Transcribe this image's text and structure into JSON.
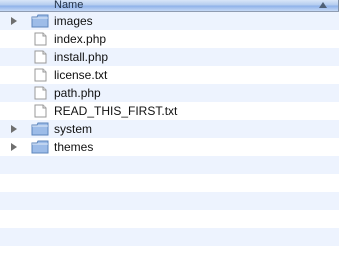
{
  "header": {
    "name_label": "Name"
  },
  "items": [
    {
      "label": "images",
      "type": "folder",
      "icon": "folder-icon",
      "expandable": true
    },
    {
      "label": "index.php",
      "type": "file",
      "icon": "document-icon",
      "expandable": false
    },
    {
      "label": "install.php",
      "type": "file",
      "icon": "document-icon",
      "expandable": false
    },
    {
      "label": "license.txt",
      "type": "file",
      "icon": "document-icon",
      "expandable": false
    },
    {
      "label": "path.php",
      "type": "file",
      "icon": "document-icon",
      "expandable": false
    },
    {
      "label": "READ_THIS_FIRST.txt",
      "type": "file",
      "icon": "document-icon",
      "expandable": false
    },
    {
      "label": "system",
      "type": "folder",
      "icon": "folder-icon",
      "expandable": true
    },
    {
      "label": "themes",
      "type": "folder",
      "icon": "folder-icon",
      "expandable": true
    }
  ],
  "colors": {
    "row_alt": "#edf3fe",
    "row_white": "#ffffff",
    "folder_blue": "#7fa9dc",
    "header_blue": "#b5cdef"
  }
}
